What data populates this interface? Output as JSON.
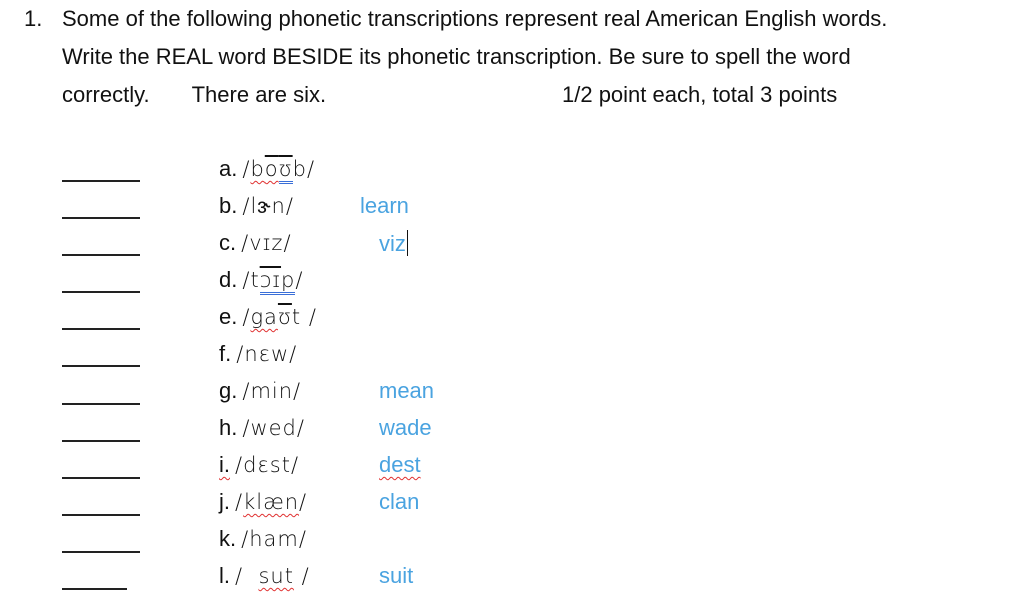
{
  "question": {
    "number": "1.",
    "line1": "Some of the following phonetic transcriptions represent real American English words.",
    "line2": "Write the REAL word BESIDE its phonetic transcription. Be sure to spell the word",
    "line3_a": "correctly.",
    "line3_b": "There are six.",
    "points": "1/2 point each, total 3 points"
  },
  "items": [
    {
      "label": "a.",
      "ipa_pre": "/",
      "ipa": "boʊb",
      "ipa_post": "/",
      "answer": ""
    },
    {
      "label": "b.",
      "ipa_pre": "/",
      "ipa": "lɝn",
      "ipa_post": "/",
      "answer": "learn"
    },
    {
      "label": "c.",
      "ipa_pre": "/",
      "ipa": "vɪz",
      "ipa_post": "/",
      "answer": "viz"
    },
    {
      "label": "d.",
      "ipa_pre": "/",
      "ipa": "tɔɪp",
      "ipa_post": "/",
      "answer": ""
    },
    {
      "label": "e.",
      "ipa_pre": "/",
      "ipa": "gaʊt",
      "ipa_post": " /",
      "answer": ""
    },
    {
      "label": "f.",
      "ipa_pre": "/",
      "ipa": "nɛw",
      "ipa_post": "/",
      "answer": ""
    },
    {
      "label": "g.",
      "ipa_pre": "/",
      "ipa": "min",
      "ipa_post": "/",
      "answer": "mean"
    },
    {
      "label": "h.",
      "ipa_pre": "/",
      "ipa": "wed",
      "ipa_post": "/",
      "answer": "wade"
    },
    {
      "label": "i.",
      "ipa_pre": "/",
      "ipa": "dɛst",
      "ipa_post": "/",
      "answer": "dest"
    },
    {
      "label": "j.",
      "ipa_pre": "/",
      "ipa": "klæn",
      "ipa_post": "/",
      "answer": "clan"
    },
    {
      "label": "k.",
      "ipa_pre": "/",
      "ipa": "ham",
      "ipa_post": "/",
      "answer": ""
    },
    {
      "label": "l.",
      "ipa_pre": "/  ",
      "ipa": "sut",
      "ipa_post": " /",
      "answer": "suit"
    }
  ],
  "colors": {
    "answer_text": "#4aa3e0",
    "spellcheck_red": "#e03030",
    "grammar_blue": "#3a6fd8"
  }
}
